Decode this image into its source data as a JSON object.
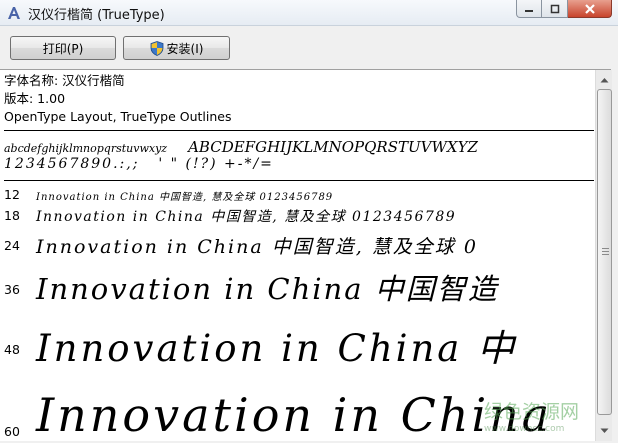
{
  "window": {
    "title": "汉仪行楷简 (TrueType)",
    "controls": [
      "minimize",
      "maximize",
      "close"
    ]
  },
  "toolbar": {
    "print_label": "打印(P)",
    "install_label": "安装(I)"
  },
  "font_info": {
    "name_line": "字体名称: 汉仪行楷简",
    "version_line": "版本: 1.00",
    "type_line": "OpenType Layout, TrueType Outlines"
  },
  "charset": {
    "lower": "abcdefghijklmnopqrstuvwxyz",
    "upper": "ABCDEFGHIJKLMNOPQRSTUVWXYZ",
    "digits": "1234567890.:,;",
    "punct": "' \" (!?) +-*/="
  },
  "samples": [
    {
      "size": "12",
      "text": "Innovation in China 中国智造, 慧及全球 0123456789"
    },
    {
      "size": "18",
      "text": "Innovation in China 中国智造, 慧及全球 0123456789"
    },
    {
      "size": "24",
      "text": "Innovation in China 中国智造, 慧及全球 0"
    },
    {
      "size": "36",
      "text": "Innovation in China 中国智造"
    },
    {
      "size": "48",
      "text": "Innovation in China 中"
    },
    {
      "size": "60",
      "text": "Innovation in China"
    }
  ],
  "watermark": {
    "text": "绿色资源网",
    "url": "www.downcc.com"
  },
  "colors": {
    "titlebar": "#e6ecf3",
    "close_button": "#c8442c",
    "content_bg": "#ffffff"
  }
}
